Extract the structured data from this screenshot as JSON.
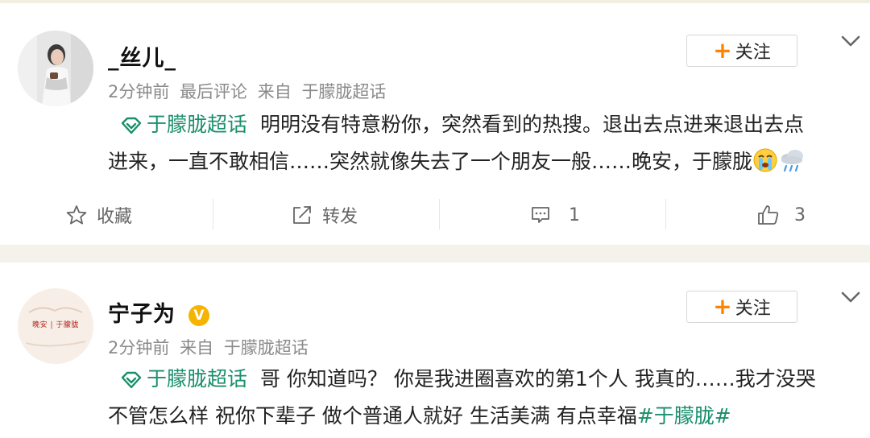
{
  "posts": [
    {
      "username": "_丝儿_",
      "time": "2分钟前",
      "meta_extra": "最后评论",
      "from_label": "来自",
      "source": "于朦胧超话",
      "follow_label": "关注",
      "topic": "于朦胧超话",
      "content_line1": "明明没有特意粉你，突然看到的热搜。退出去点进来退出去点",
      "content_line2": "进来，一直不敢相信……突然就像失去了一个朋友一般……晚安，于朦胧",
      "emojis": [
        "crying-face",
        "cloud-rain"
      ],
      "actions": {
        "favorite_label": "收藏",
        "repost_label": "转发",
        "comment_count": "1",
        "like_count": "3"
      }
    },
    {
      "username": "宁子为",
      "verified_badge": "V",
      "avatar_text": "晚安 | 于朦胧",
      "time": "2分钟前",
      "from_label": "来自",
      "source": "于朦胧超话",
      "follow_label": "关注",
      "topic": "于朦胧超话",
      "content_line1": "哥 你知道吗？ 你是我进圈喜欢的第1个人 我真的……我才没哭",
      "content_line2": "不管怎么样 祝你下辈子 做个普通人就好 生活美满 有点幸福",
      "hashtag": "#于朦胧#"
    }
  ],
  "colors": {
    "topic_green": "#1a8f6c",
    "follow_plus": "#ff8200",
    "verified_gold": "#f5b400",
    "meta_gray": "#8a8a8a"
  }
}
